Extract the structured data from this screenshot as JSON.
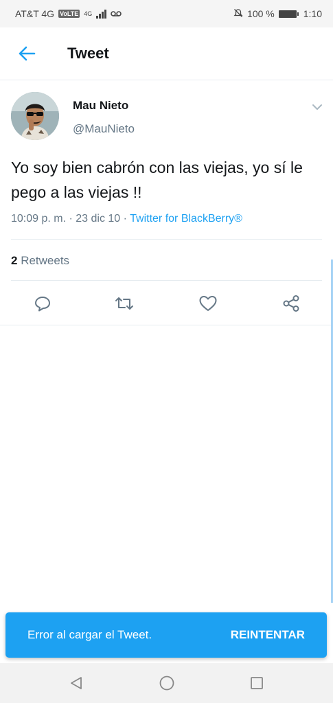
{
  "status_bar": {
    "carrier": "AT&T 4G",
    "volte": "VoLTE",
    "network": "4G",
    "battery": "100 %",
    "time": "1:10"
  },
  "header": {
    "title": "Tweet"
  },
  "tweet": {
    "author_name": "Mau Nieto",
    "author_handle": "@MauNieto",
    "text": "Yo soy bien cabrón con las viejas, yo sí le pego a las viejas !!",
    "time": "10:09 p. m. · 23 dic 10 · ",
    "source": "Twitter for BlackBerry®",
    "retweet_count": "2",
    "retweet_label": " Retweets"
  },
  "actions": {
    "icons": [
      "reply-icon",
      "retweet-icon",
      "like-icon",
      "share-icon"
    ]
  },
  "toast": {
    "message": "Error al cargar el Tweet.",
    "action_label": "REINTENTAR"
  },
  "colors": {
    "accent": "#1da1f2",
    "text": "#14171a",
    "secondary": "#657786"
  }
}
